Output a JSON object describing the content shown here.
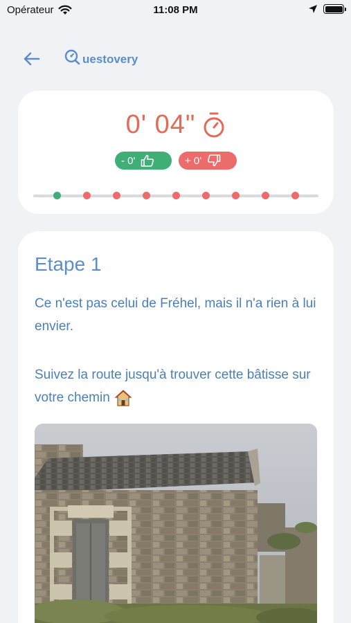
{
  "status_bar": {
    "carrier": "Opérateur",
    "time": "11:08 PM",
    "icons": [
      "wifi-icon",
      "location-arrow-icon",
      "battery-icon"
    ]
  },
  "header": {
    "brand": "uestovery",
    "icons": [
      "back-arrow-icon",
      "brand-logo-icon"
    ]
  },
  "timer": {
    "value": "0' 04\"",
    "icon": "stopwatch-icon",
    "bonus_label": "- 0'",
    "penalty_label": "+ 0'",
    "bonus_icon": "thumbs-up-icon",
    "penalty_icon": "thumbs-down-icon",
    "steps_total": 9,
    "steps_done": 1
  },
  "step": {
    "title": "Etape 1",
    "paragraph1": "Ce n'est pas celui de Fréhel, mais il n'a rien à lui envier.",
    "paragraph2": "Suivez la route jusqu'à trouver cette bâtisse sur votre chemin",
    "emoji_icon": "house-icon",
    "photo": "stone-building-photo"
  },
  "colors": {
    "accent_blue": "#5b8dc9",
    "timer_red": "#e26a56",
    "green": "#3fae77",
    "red": "#ec6b6b",
    "background": "#f1f2f5"
  }
}
